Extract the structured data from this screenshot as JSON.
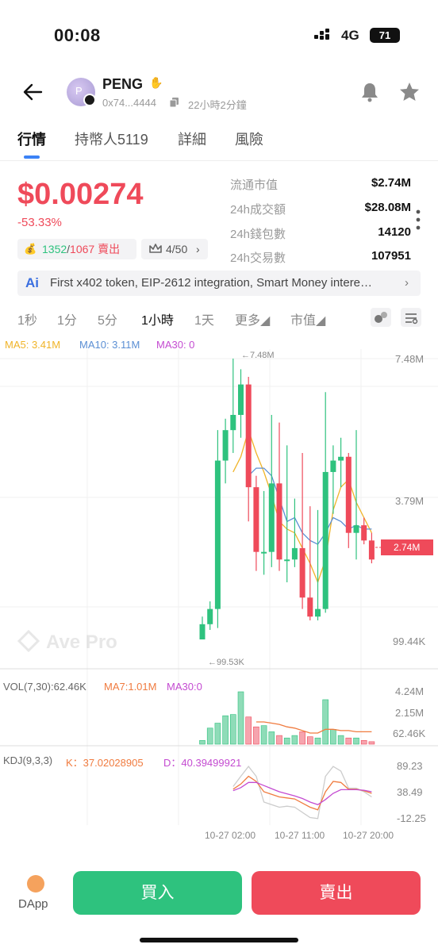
{
  "status": {
    "time": "00:08",
    "network": "4G",
    "battery": "71"
  },
  "token": {
    "name": "PENG",
    "avatar_letter": "P",
    "address": "0x74...4444",
    "age": "22小時2分鐘"
  },
  "tabs": [
    {
      "label": "行情",
      "active": true
    },
    {
      "label": "持幣人5119",
      "active": false
    },
    {
      "label": "詳細",
      "active": false
    },
    {
      "label": "風險",
      "active": false
    }
  ],
  "price": {
    "value": "$0.00274",
    "change": "-53.33%",
    "buy_count": "1352",
    "slash": "/",
    "sell_count": "1067",
    "sell_label": "賣出",
    "crown_ratio": "4/50",
    "crown_chevron": "›"
  },
  "stats": [
    {
      "label": "流通市值",
      "value": "$2.74M"
    },
    {
      "label": "24h成交額",
      "value": "$28.08M"
    },
    {
      "label": "24h錢包數",
      "value": "14120"
    },
    {
      "label": "24h交易數",
      "value": "107951"
    }
  ],
  "ai_bar": {
    "logo": "Ai",
    "text": "First x402 token, EIP-2612 integration, Smart Money intere…",
    "chevron": "›"
  },
  "intervals": [
    "1秒",
    "1分",
    "5分",
    "1小時",
    "1天",
    "更多◢",
    "市值◢"
  ],
  "active_interval": "1小時",
  "colors": {
    "up": "#2ec27e",
    "down": "#ef4a5a",
    "ma5": "#f0b429",
    "ma10": "#5b8fd4",
    "ma30": "#c44bd1",
    "accent": "#3b82f6"
  },
  "chart_data": {
    "type": "candlestick",
    "legend": {
      "ma5": "MA5: 3.41M",
      "ma10": "MA10: 3.11M",
      "ma30": "MA30: 0"
    },
    "price_axis": [
      "7.48M",
      "3.79M",
      "99.44K"
    ],
    "max_label": "←7.48M",
    "min_label": "←99.53K",
    "current_label": "2.74M",
    "watermark": "Ave Pro",
    "time_labels": [
      "10-27 02:00",
      "10-27 11:00",
      "10-27 20:00"
    ],
    "candles": [
      {
        "o": 0.1,
        "c": 0.5,
        "h": 0.7,
        "l": 0.1
      },
      {
        "o": 0.5,
        "c": 0.9,
        "h": 1.1,
        "l": 0.35
      },
      {
        "o": 0.9,
        "c": 4.8,
        "h": 5.6,
        "l": 0.4
      },
      {
        "o": 4.8,
        "c": 5.6,
        "h": 5.9,
        "l": 4.2
      },
      {
        "o": 5.6,
        "c": 6.0,
        "h": 7.48,
        "l": 5.0
      },
      {
        "o": 6.0,
        "c": 6.8,
        "h": 7.2,
        "l": 5.4
      },
      {
        "o": 6.8,
        "c": 4.1,
        "h": 7.0,
        "l": 3.2
      },
      {
        "o": 4.1,
        "c": 2.4,
        "h": 4.4,
        "l": 1.9
      },
      {
        "o": 2.4,
        "c": 2.4,
        "h": 4.0,
        "l": 1.8
      },
      {
        "o": 2.4,
        "c": 4.2,
        "h": 6.0,
        "l": 2.0
      },
      {
        "o": 4.2,
        "c": 2.2,
        "h": 5.8,
        "l": 1.9
      },
      {
        "o": 2.2,
        "c": 2.2,
        "h": 5.2,
        "l": 1.6
      },
      {
        "o": 2.2,
        "c": 2.5,
        "h": 3.8,
        "l": 2.0
      },
      {
        "o": 2.5,
        "c": 1.2,
        "h": 5.0,
        "l": 0.9
      },
      {
        "o": 1.2,
        "c": 0.7,
        "h": 3.6,
        "l": 0.6
      },
      {
        "o": 0.7,
        "c": 0.9,
        "h": 3.5,
        "l": 0.6
      },
      {
        "o": 0.9,
        "c": 4.5,
        "h": 6.6,
        "l": 0.8
      },
      {
        "o": 4.5,
        "c": 4.8,
        "h": 5.2,
        "l": 3.4
      },
      {
        "o": 4.8,
        "c": 4.9,
        "h": 5.4,
        "l": 4.1
      },
      {
        "o": 4.9,
        "c": 2.9,
        "h": 5.0,
        "l": 2.5
      },
      {
        "o": 2.9,
        "c": 3.1,
        "h": 5.6,
        "l": 2.2
      },
      {
        "o": 3.1,
        "c": 2.7,
        "h": 3.3,
        "l": 2.6
      },
      {
        "o": 2.7,
        "c": 2.2,
        "h": 2.9,
        "l": 2.1
      }
    ],
    "ma5_line": [
      null,
      null,
      null,
      null,
      4.5,
      4.9,
      5.6,
      5.0,
      4.5,
      3.9,
      3.2,
      3.0,
      2.9,
      2.5,
      2.1,
      1.6,
      2.2,
      3.5,
      4.1,
      4.3,
      3.7,
      3.3,
      2.9
    ],
    "ma10_line": [
      null,
      null,
      null,
      null,
      null,
      null,
      4.4,
      4.6,
      4.6,
      4.4,
      3.8,
      3.2,
      3.3,
      2.9,
      2.7,
      2.6,
      2.9,
      3.3,
      3.2,
      3.0,
      3.1,
      3.0,
      3.0
    ],
    "vol_legend": {
      "vol": "VOL(7,30):62.46K",
      "ma7": "MA7:1.01M",
      "ma30": "MA30:0"
    },
    "vol_axis": [
      "4.24M",
      "2.15M",
      "62.46K"
    ],
    "volumes": [
      0.3,
      1.3,
      1.7,
      2.3,
      2.4,
      4.24,
      2.2,
      1.4,
      1.5,
      1.0,
      0.7,
      0.5,
      0.7,
      1.0,
      0.6,
      0.5,
      3.6,
      1.2,
      0.7,
      0.5,
      0.5,
      0.3,
      0.2
    ],
    "vol_ma7": [
      null,
      null,
      null,
      null,
      null,
      null,
      null,
      1.8,
      1.8,
      1.7,
      1.6,
      1.4,
      1.3,
      1.1,
      0.9,
      0.9,
      1.2,
      1.2,
      1.1,
      1.1,
      1.0,
      1.0,
      1.0
    ],
    "kdj_legend": {
      "kdj": "KDJ(9,3,3)",
      "k": "K：37.02028905",
      "d": "D：40.39499921"
    },
    "kdj_axis": [
      "89.23",
      "38.49",
      "-12.25"
    ],
    "kdj_k": [
      null,
      null,
      null,
      null,
      45,
      55,
      70,
      60,
      40,
      35,
      30,
      28,
      26,
      18,
      10,
      5,
      40,
      60,
      58,
      45,
      45,
      42,
      37
    ],
    "kdj_d": [
      null,
      null,
      null,
      null,
      42,
      48,
      58,
      58,
      52,
      46,
      40,
      36,
      32,
      27,
      20,
      15,
      25,
      37,
      44,
      44,
      44,
      43,
      40
    ],
    "kdj_j": [
      null,
      null,
      null,
      null,
      50,
      70,
      89,
      70,
      20,
      15,
      10,
      12,
      10,
      0,
      -10,
      -12,
      70,
      89,
      80,
      47,
      47,
      40,
      30
    ]
  },
  "bottom": {
    "dapp": "DApp",
    "buy": "買入",
    "sell": "賣出"
  }
}
